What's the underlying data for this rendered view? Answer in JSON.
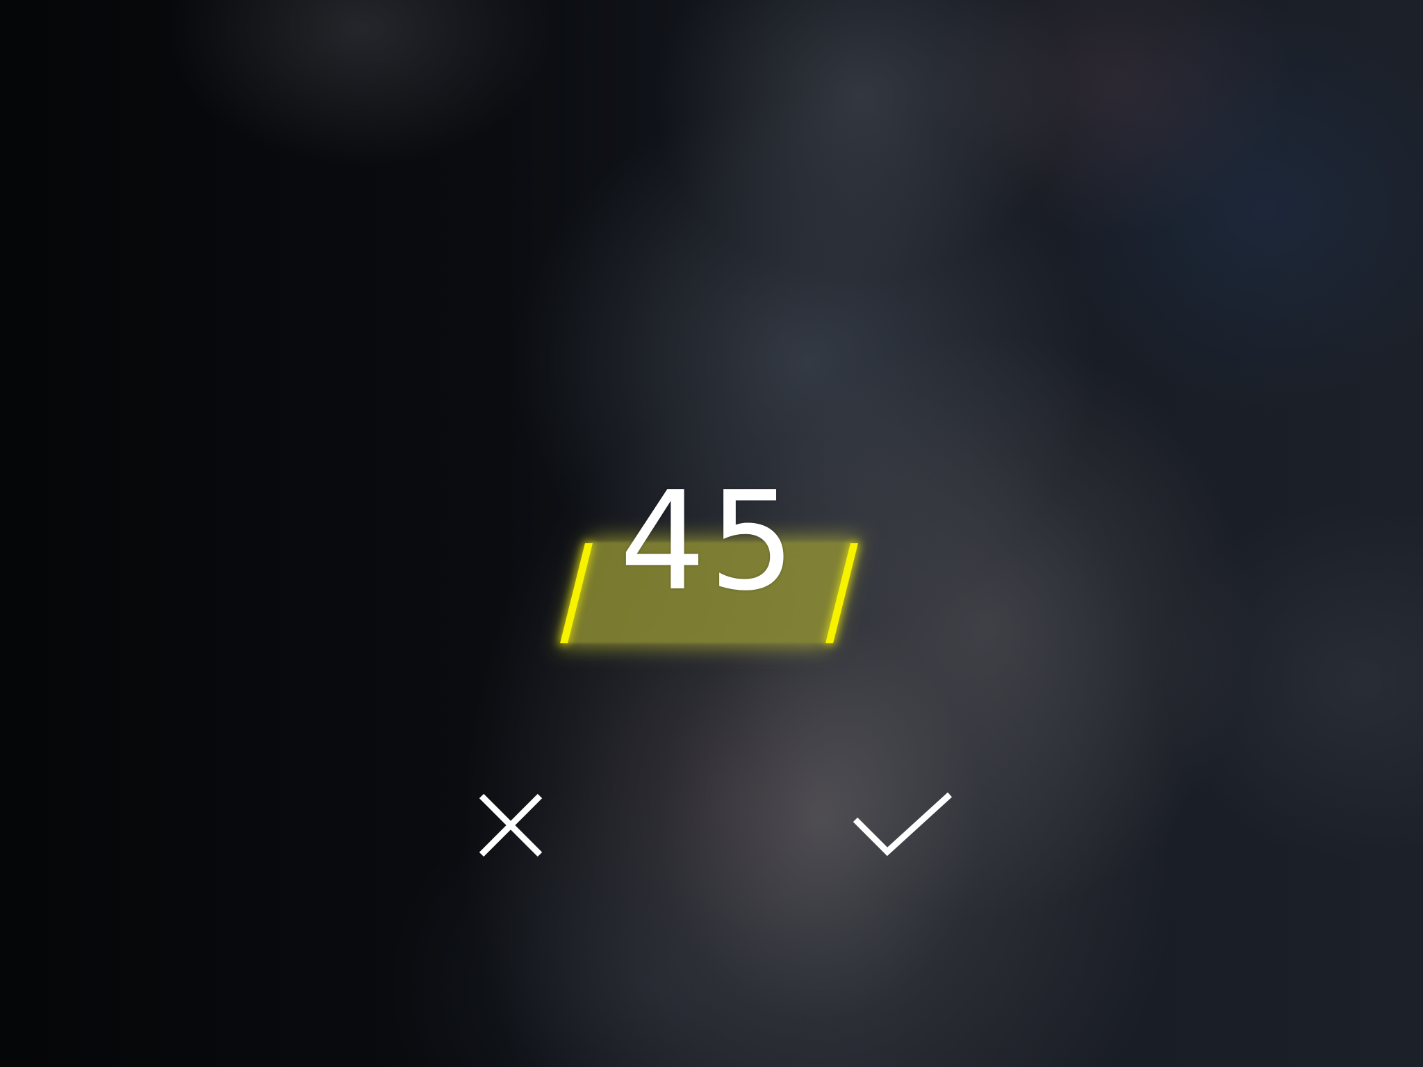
{
  "picker": {
    "value": "45",
    "highlight_color": "#f7f200"
  },
  "actions": {
    "cancel": {
      "icon": "close-icon"
    },
    "confirm": {
      "icon": "checkmark-icon"
    }
  }
}
